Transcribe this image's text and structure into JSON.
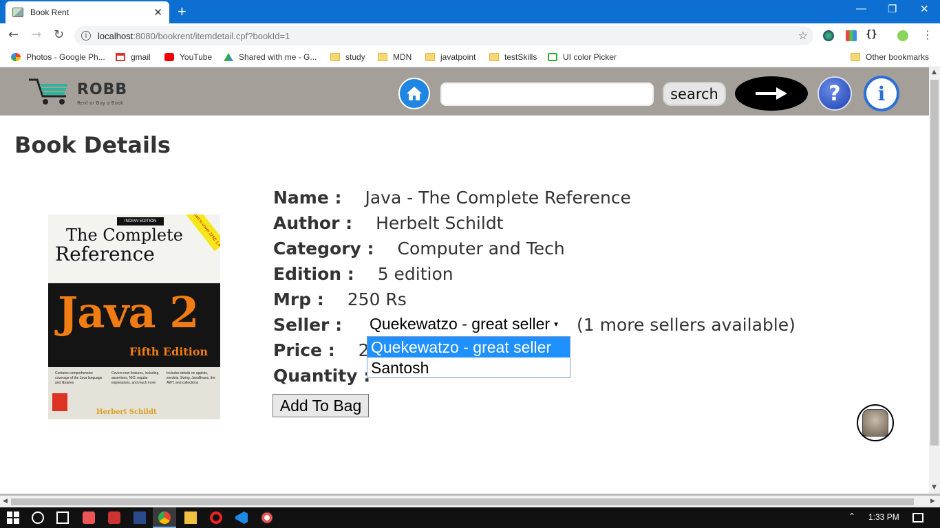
{
  "browser": {
    "tab_title": "Book Rent",
    "tab_close": "✕",
    "new_tab": "+",
    "url_host": "localhost",
    "url_rest": ":8080/bookrent/itemdetail.cpf?bookId=1"
  },
  "bookmarks": [
    {
      "label": "Photos - Google Ph..."
    },
    {
      "label": "gmail"
    },
    {
      "label": "YouTube"
    },
    {
      "label": "Shared with me - G..."
    },
    {
      "label": "study"
    },
    {
      "label": "MDN"
    },
    {
      "label": "javatpoint"
    },
    {
      "label": "testSkills"
    },
    {
      "label": "UI color Picker"
    },
    {
      "label": "Other bookmarks"
    }
  ],
  "header": {
    "logo_text": "ROBB",
    "logo_sub": "Rent or Buy a Book",
    "search_value": "",
    "search_button": "search",
    "help_glyph": "?",
    "info_glyph": "i"
  },
  "page": {
    "title": "Book Details"
  },
  "cover": {
    "badge": "INDIAN EDITION",
    "corner": "Updated to cover J2SE 1.4",
    "title_line1": "The Complete",
    "title_line2": "Reference",
    "java": "Java 2",
    "edition": "Fifth Edition",
    "col1": "Contains comprehensive coverage of the Java language and libraries",
    "col2": "Covers new features, including assertions, NIO, regular expressions, and much more",
    "col3": "Includes details on applets, servlets, Swing, JavaBeans, the AWT, and collections",
    "author": "Herbert Schildt"
  },
  "details": {
    "name_label": "Name :",
    "name_value": "Java - The Complete Reference",
    "author_label": "Author :",
    "author_value": "Herbelt Schildt",
    "category_label": "Category :",
    "category_value": "Computer and Tech",
    "edition_label": "Edition :",
    "edition_value": "5 edition",
    "mrp_label": "Mrp :",
    "mrp_value": "250 Rs",
    "seller_label": "Seller :",
    "seller_selected": "Quekewatzo - great seller",
    "more_sellers": "(1 more sellers available)",
    "price_label": "Price :",
    "price_value": "2",
    "quantity_label": "Quantity :",
    "add_button": "Add To Bag"
  },
  "seller_options": [
    {
      "label": "Quekewatzo - great seller",
      "selected": true
    },
    {
      "label": "Santosh",
      "selected": false
    }
  ],
  "taskbar": {
    "time": "1:33 PM"
  },
  "colors": {
    "header_bg": "#a59f9a",
    "tabstrip": "#0d6fd1",
    "selected_option": "#1e90ff"
  }
}
